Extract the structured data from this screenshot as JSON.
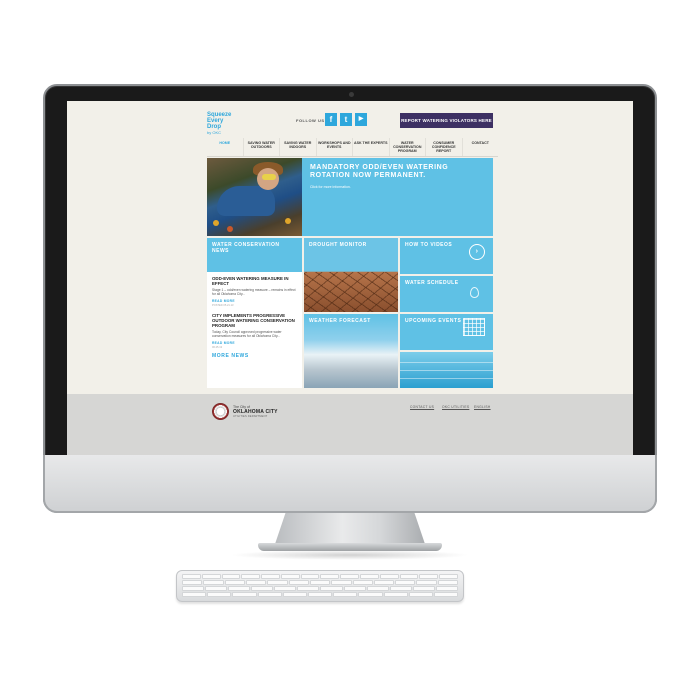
{
  "header": {
    "logo_lines": [
      "Squeeze",
      "Every",
      "Drop"
    ],
    "logo_small": "by OKC",
    "follow_label": "FOLLOW US",
    "social_icons": [
      {
        "name": "facebook-icon",
        "glyph": "f"
      },
      {
        "name": "twitter-icon",
        "glyph": "t"
      },
      {
        "name": "youtube-icon",
        "glyph": "▶"
      }
    ],
    "report_button": "REPORT WATERING VIOLATORS HERE"
  },
  "nav": {
    "items": [
      {
        "label": "HOME",
        "active": true
      },
      {
        "label": "SAVING WATER OUTDOORS",
        "active": false
      },
      {
        "label": "SAVING WATER INDOORS",
        "active": false
      },
      {
        "label": "WORKSHOPS AND EVENTS",
        "active": false
      },
      {
        "label": "ASK THE EXPERTS",
        "active": false
      },
      {
        "label": "WATER CONSERVATION PROGRAM",
        "active": false
      },
      {
        "label": "CONSUMER CONFIDENCE REPORT",
        "active": false
      },
      {
        "label": "CONTACT",
        "active": false
      }
    ]
  },
  "hero": {
    "title": "MANDATORY ODD/EVEN WATERING ROTATION NOW PERMANENT.",
    "subtitle": "Click for more information."
  },
  "tiles": {
    "news_heading": "WATER CONSERVATION NEWS",
    "drought": "DROUGHT MONITOR",
    "howto": "HOW TO VIDEOS",
    "schedule": "WATER SCHEDULE",
    "weather": "WEATHER FORECAST",
    "upcoming": "UPCOMING EVENTS"
  },
  "news": {
    "items": [
      {
        "title": "ODD-EVEN WATERING MEASURE IN EFFECT",
        "body": "Stage 1 – odd/even watering measure – remains in effect for all Oklahoma City...",
        "read_more": "READ MORE",
        "date": "POSTED 05.21.13"
      },
      {
        "title": "CITY IMPLEMENTS PROGRESSIVE OUTDOOR WATERING CONSERVATION PROGRAM",
        "body": "Today, City Council approved progressive water conservation measures for all Oklahoma City...",
        "read_more": "READ MORE",
        "date": "06.25.13"
      }
    ],
    "more_news": "MORE NEWS"
  },
  "footer": {
    "city_line1": "The City of",
    "city_name": "OKLAHOMA CITY",
    "city_dept": "UTILITIES DEPARTMENT",
    "links": [
      "CONTACT US",
      "OKC UTILITIES",
      "ENGLISH"
    ]
  },
  "colors": {
    "accent": "#2ea7dc",
    "tile_blue": "#5fc1e5",
    "report_button": "#3d3063",
    "page_bg": "#f2f0e9",
    "footer_bg": "#d6d6d4"
  }
}
